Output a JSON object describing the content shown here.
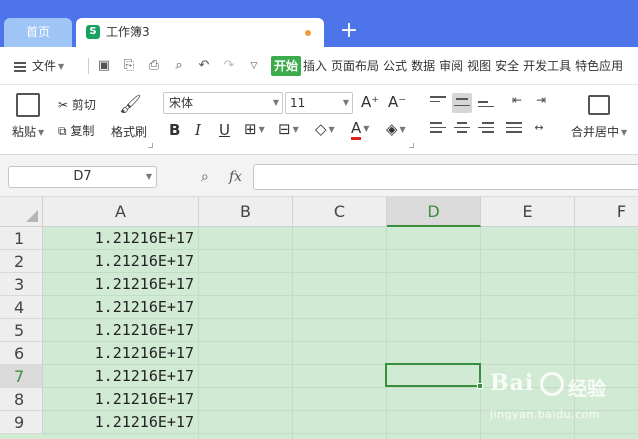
{
  "tabs": {
    "home_label": "首页",
    "doc_title": "工作簿3",
    "doc_icon_letter": "S",
    "add_tab": "+"
  },
  "menu": {
    "file_label": "文件",
    "tabs": [
      "开始",
      "插入",
      "页面布局",
      "公式",
      "数据",
      "审阅",
      "视图",
      "安全",
      "开发工具",
      "特色应用"
    ],
    "active_tab": "开始"
  },
  "ribbon": {
    "paste_label": "粘贴",
    "cut_label": "剪切",
    "copy_label": "复制",
    "format_painter_label": "格式刷",
    "font_name": "宋体",
    "font_size": "11",
    "grow_font": "A⁺",
    "shrink_font": "A⁻",
    "bold": "B",
    "italic": "I",
    "underline": "U",
    "merge_center_label": "合并居中",
    "font_color": "#e02020"
  },
  "formula_bar": {
    "name_box": "D7",
    "fx_label": "fx",
    "formula": ""
  },
  "sheet": {
    "columns": [
      "A",
      "B",
      "C",
      "D",
      "E",
      "F"
    ],
    "selected_column": "D",
    "rows": [
      "1",
      "2",
      "3",
      "4",
      "5",
      "6",
      "7",
      "8",
      "9"
    ],
    "selected_row": "7",
    "column_a_values": [
      "1.21216E+17",
      "1.21216E+17",
      "1.21216E+17",
      "1.21216E+17",
      "1.21216E+17",
      "1.21216E+17",
      "1.21216E+17",
      "1.21216E+17",
      "1.21216E+17"
    ],
    "active_cell": "D7",
    "fill_color": "#d0ead4"
  },
  "watermark": {
    "brand": "Bai",
    "brand_cn": "经验",
    "url": "jingyan.baidu.com"
  }
}
